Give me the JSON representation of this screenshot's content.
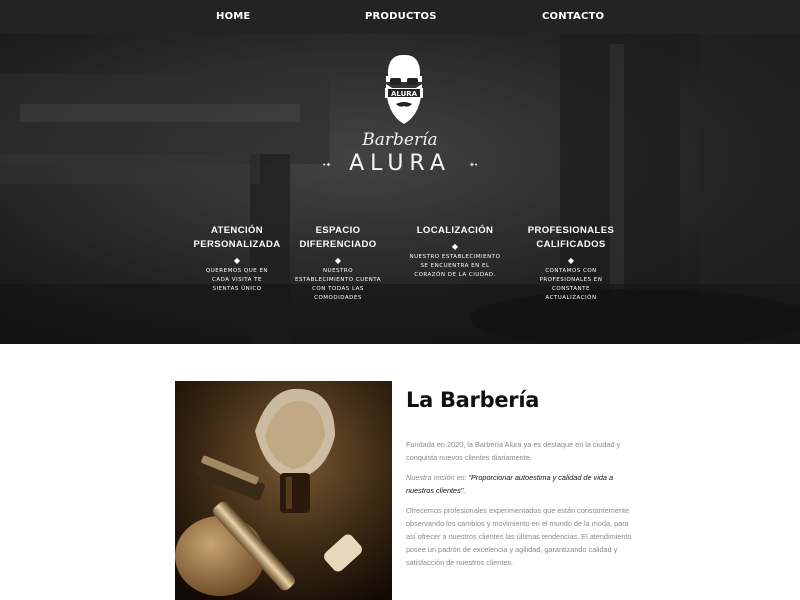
{
  "nav": {
    "home": "HOME",
    "productos": "PRODUCTOS",
    "contacto": "CONTACTO"
  },
  "hero": {
    "brand_script": "Barbería",
    "brand_title": "ALURA",
    "logo_text": "ALURA",
    "features": [
      {
        "title_line1": "ATENCIÓN",
        "title_line2": "PERSONALIZADA",
        "text": "QUEREMOS QUE EN CADA VISITA TE SIENTAS ÚNICO"
      },
      {
        "title_line1": "ESPACIO",
        "title_line2": "DIFERENCIADO",
        "text": "NUESTRO ESTABLECIMIENTO CUENTA CON TODAS LAS COMODIDADES"
      },
      {
        "title_line1": "LOCALIZACIÓN",
        "title_line2": "",
        "text": "NUESTRO ESTABLECIMIENTO SE ENCUENTRA EN EL CORAZÓN DE LA CIUDAD."
      },
      {
        "title_line1": "PROFESIONALES",
        "title_line2": "CALIFICADOS",
        "text": "CONTAMOS CON PROFESIONALES EN CONSTANTE ACTUALIZACIÓN"
      }
    ]
  },
  "about": {
    "title": "La Barbería",
    "paragraph1": "Fundada en 2020, la Barbería Alura ya es destaque en la ciudad y conquista nuevos clientes diariamente.",
    "mission_label": "Nuestra misión es:",
    "mission_quote": "\"Proporcionar autoestima y calidad de vida a nuestros clientes\".",
    "paragraph3": "Ofrecemos profesionales experimentados que están constantemente observando los cambios y movimiento en el mundo de la moda, para así ofrecer a nuestros clientes las últimas tendencias. El atendimiento posee un padrón de excelencia y agilidad, garantizando calidad y satisfacción de nuestros clientes."
  }
}
